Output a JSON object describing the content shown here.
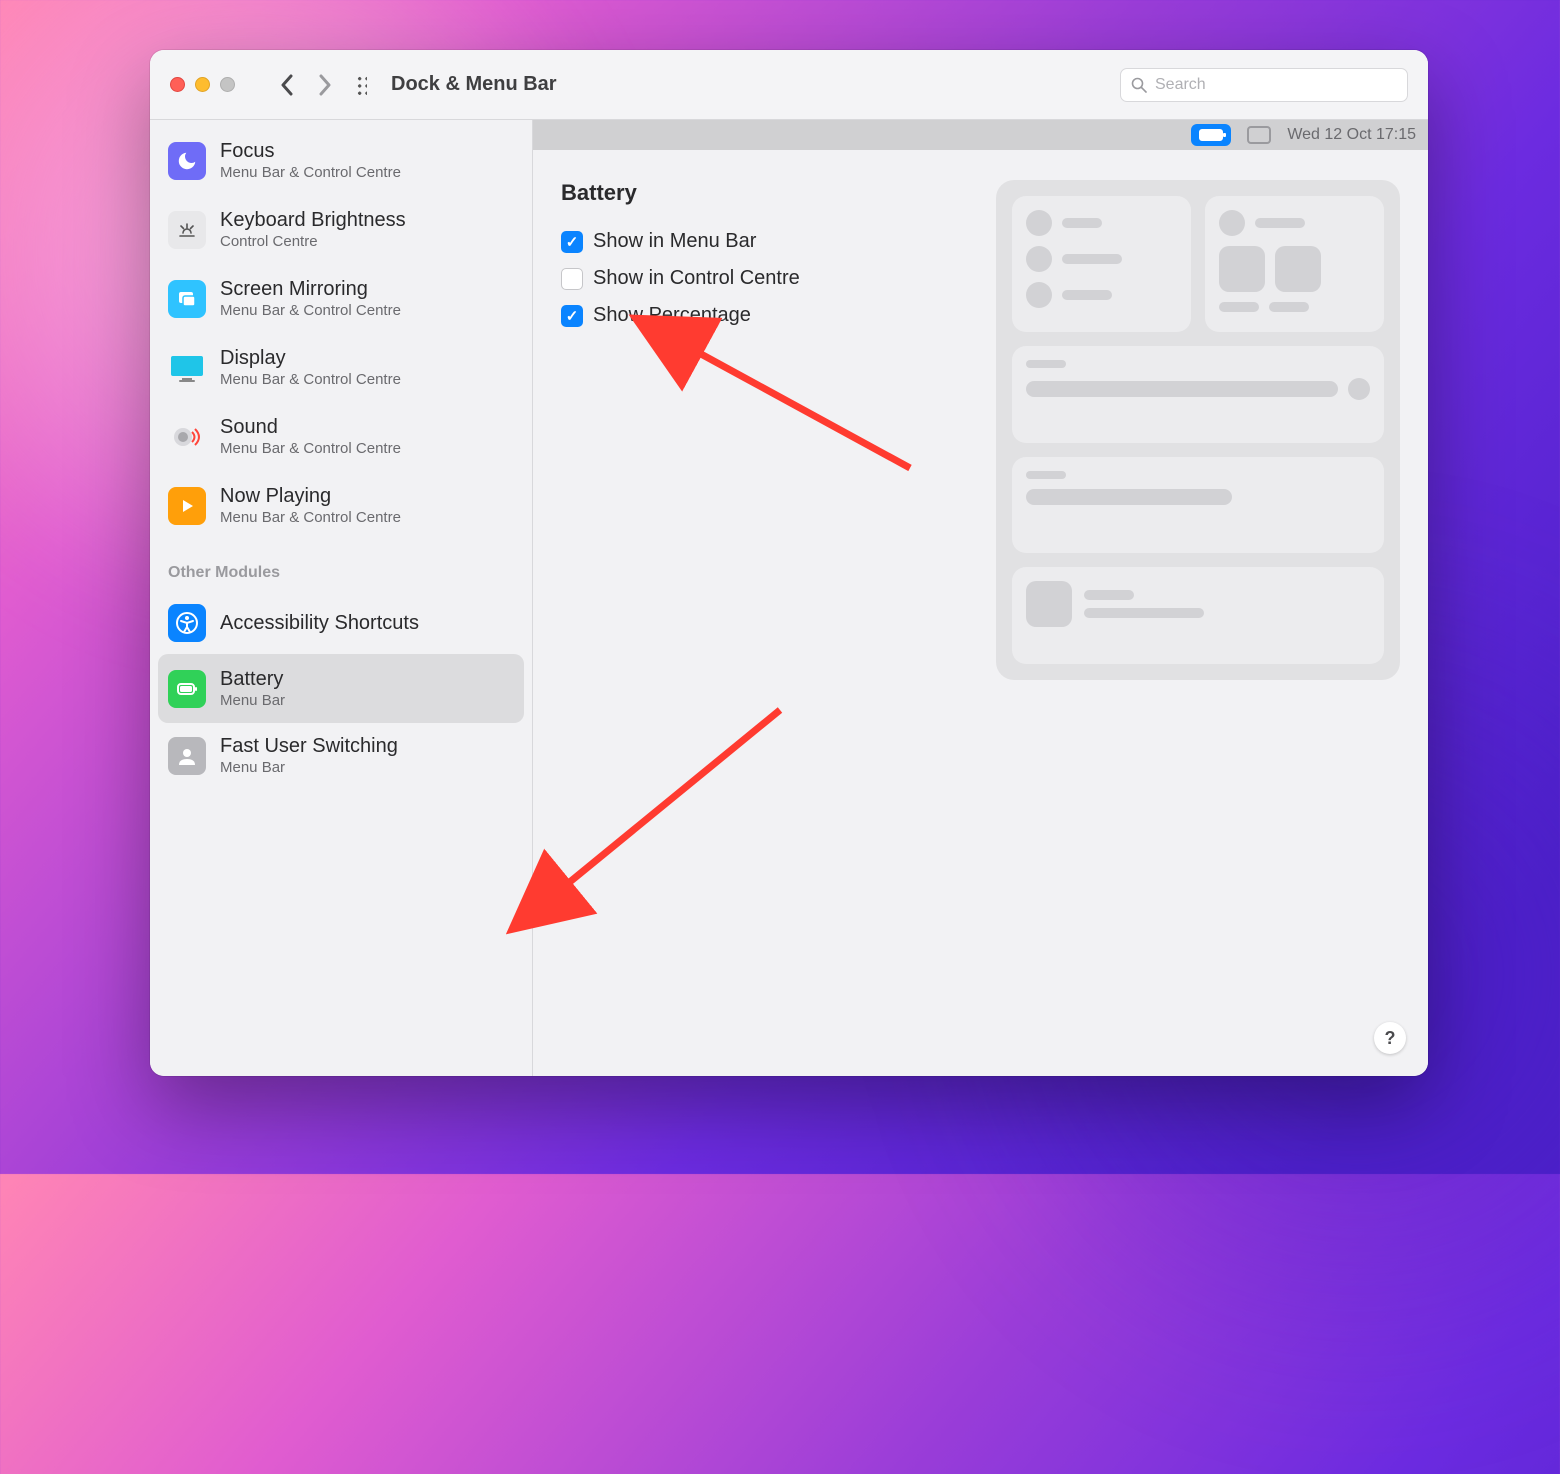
{
  "window": {
    "title": "Dock & Menu Bar",
    "search_placeholder": "Search"
  },
  "menubar": {
    "datetime": "Wed 12 Oct  17:15"
  },
  "sidebar": {
    "section_header": "Other Modules",
    "items": [
      {
        "label": "Focus",
        "sub": "Menu Bar & Control Centre",
        "icon": "focus",
        "color": "#6f6cf7"
      },
      {
        "label": "Keyboard Brightness",
        "sub": "Control Centre",
        "icon": "keyboard-brightness",
        "color": "#d8d8dc"
      },
      {
        "label": "Screen Mirroring",
        "sub": "Menu Bar & Control Centre",
        "icon": "screen-mirroring",
        "color": "#2fc3ff"
      },
      {
        "label": "Display",
        "sub": "Menu Bar & Control Centre",
        "icon": "display",
        "color": "#1fb8d6"
      },
      {
        "label": "Sound",
        "sub": "Menu Bar & Control Centre",
        "icon": "sound",
        "color": "#e8e8ea"
      },
      {
        "label": "Now Playing",
        "sub": "Menu Bar & Control Centre",
        "icon": "now-playing",
        "color": "#ff9f0a"
      }
    ],
    "other": [
      {
        "label": "Accessibility Shortcuts",
        "sub": "",
        "icon": "accessibility",
        "color": "#0a84ff"
      },
      {
        "label": "Battery",
        "sub": "Menu Bar",
        "icon": "battery",
        "color": "#30d158",
        "selected": true
      },
      {
        "label": "Fast User Switching",
        "sub": "Menu Bar",
        "icon": "fast-user-switching",
        "color": "#9a9a9e"
      }
    ]
  },
  "settings": {
    "title": "Battery",
    "options": [
      {
        "label": "Show in Menu Bar",
        "checked": true
      },
      {
        "label": "Show in Control Centre",
        "checked": false
      },
      {
        "label": "Show Percentage",
        "checked": true
      }
    ]
  },
  "help_label": "?"
}
